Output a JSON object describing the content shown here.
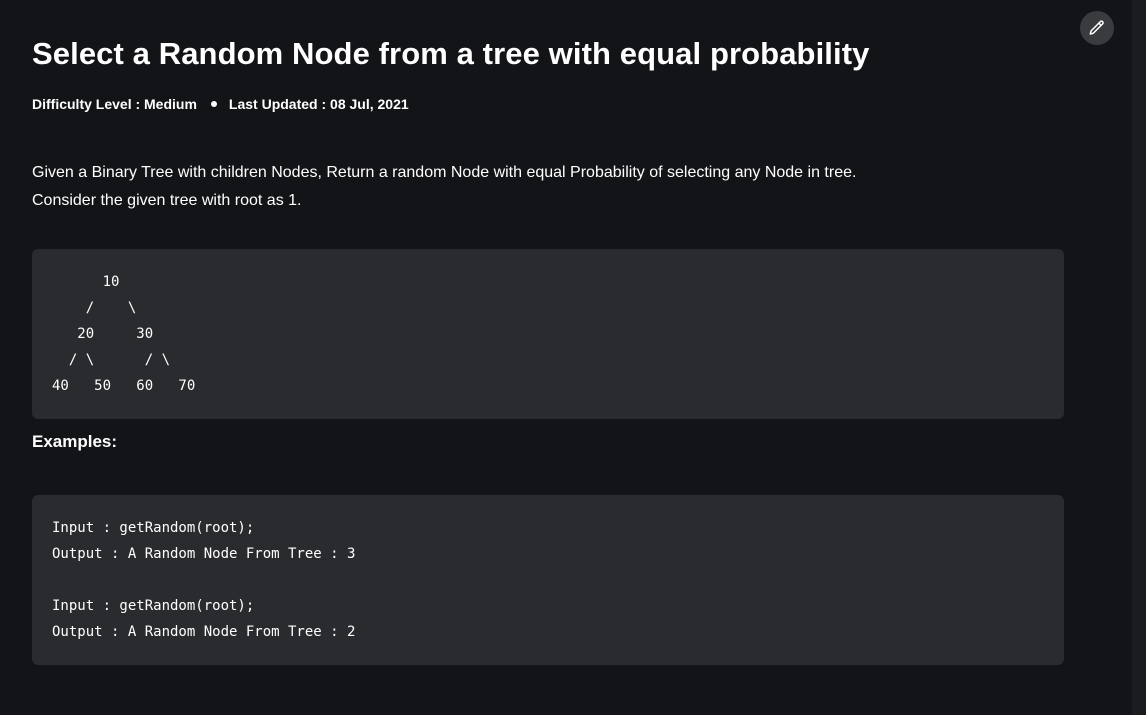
{
  "article": {
    "title": "Select a Random Node from a tree with equal probability",
    "difficulty": "Difficulty Level : Medium",
    "last_updated": "Last Updated : 08 Jul, 2021",
    "intro_line1": "Given a Binary Tree with children Nodes, Return a random Node with equal Probability of selecting any Node in tree.",
    "intro_line2": "Consider the given tree with root as 1.",
    "tree_code": "      10\n    /    \\\n   20     30\n  / \\      / \\\n40   50   60   70",
    "examples_heading": "Examples:",
    "example_code": "Input : getRandom(root);\nOutput : A Random Node From Tree : 3\n\nInput : getRandom(root);\nOutput : A Random Node From Tree : 2"
  },
  "toolbar": {
    "edit_icon": "pencil-icon"
  },
  "colors": {
    "background": "#131417",
    "code_background": "#2a2b2f",
    "edit_button_background": "#3a3b3f",
    "text": "#ffffff"
  }
}
